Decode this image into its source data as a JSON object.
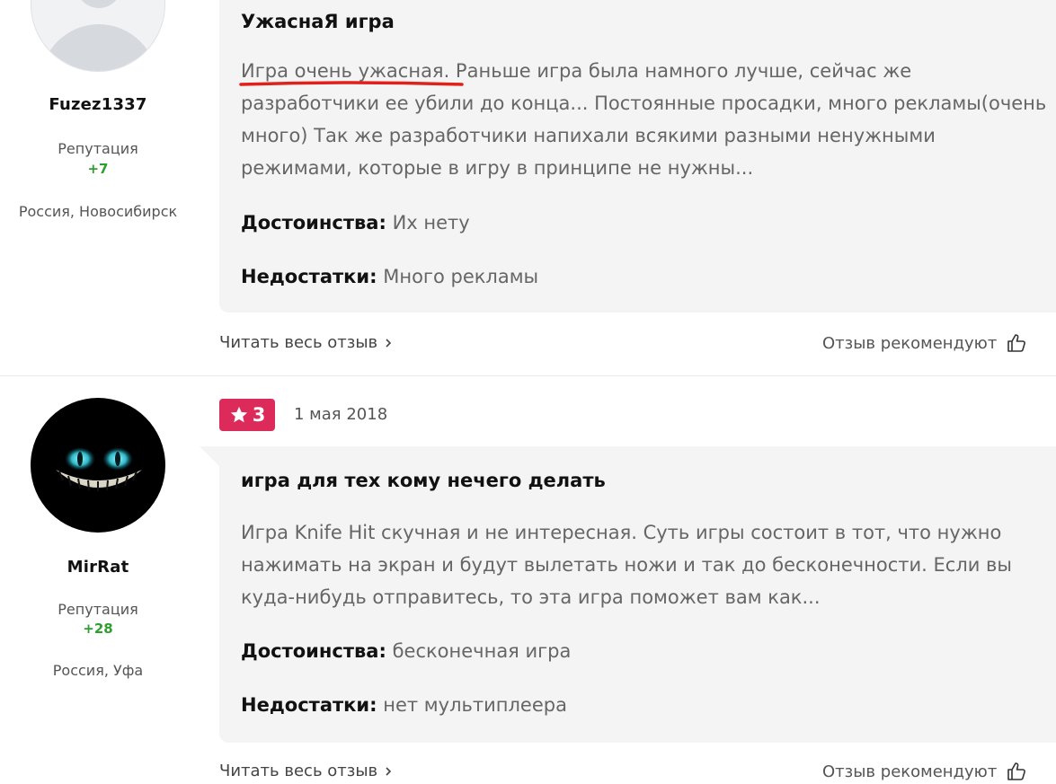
{
  "reviews": [
    {
      "user": {
        "name": "Fuzez1337",
        "reputation_label": "Репутация",
        "reputation_value": "+7",
        "location": "Россия, Новосибирск"
      },
      "title": "УжаснаЯ игра",
      "text_highlight": "Игра очень ужасная",
      "text_rest": ". Раньше игра была намного лучше, сейчас же разработчики ее убили до конца... Постоянные просадки, много рекламы(очень много) Так же разработчики напихали всякими разными ненужными режимами, которые в игру в принципе не нужны...",
      "pros_label": "Достоинства:",
      "pros_value": "Их нету",
      "cons_label": "Недостатки:",
      "cons_value": "Много рекламы",
      "read_more": "Читать весь отзыв",
      "recommend_label": "Отзыв рекомендуют"
    },
    {
      "user": {
        "name": "MirRat",
        "reputation_label": "Репутация",
        "reputation_value": "+28",
        "location": "Россия, Уфа"
      },
      "rating": "3",
      "date": "1 мая 2018",
      "title": "игра для тех кому нечего делать",
      "text": "Игра Knife Hit скучная и не интересная. Суть игры состоит в тот, что нужно нажимать на экран и будут вылетать ножи и так до бесконечности. Если вы куда-нибудь отправитесь, то эта игра поможет вам как...",
      "pros_label": "Достоинства:",
      "pros_value": "бесконечная игра",
      "cons_label": "Недостатки:",
      "cons_value": "нет мультиплеера",
      "read_more": "Читать весь отзыв",
      "recommend_label": "Отзыв рекомендуют"
    }
  ],
  "colors": {
    "rating_badge": "#dc2a5a",
    "reputation_positive": "#2e9e2e",
    "highlight_underline": "#e0201a",
    "card_background": "#f4f4f5"
  },
  "icons": {
    "rating": "star-icon",
    "read_more": "chevron-right-icon",
    "recommend": "thumbs-up-icon",
    "avatar_default": "default-user-icon"
  }
}
